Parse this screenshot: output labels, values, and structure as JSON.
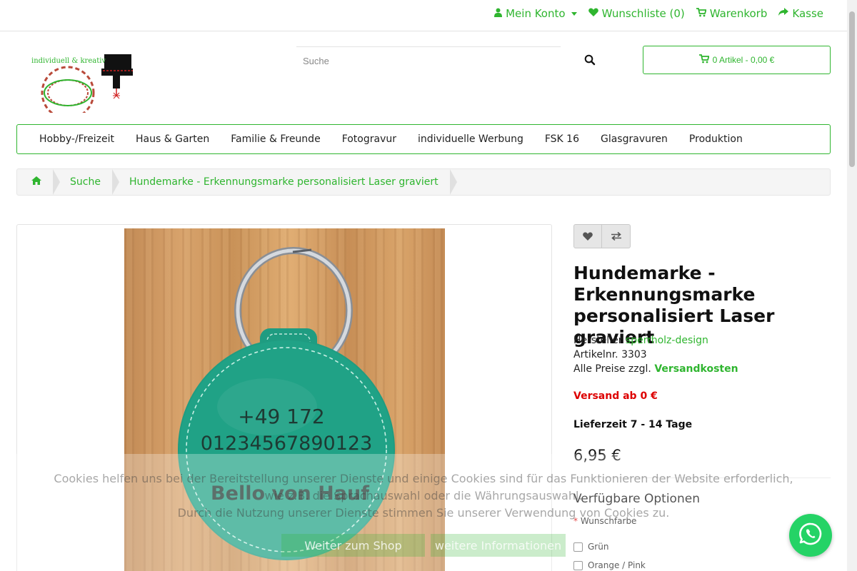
{
  "topbar": {
    "account": "Mein Konto",
    "wishlist": "Wunschliste (0)",
    "cart": "Warenkorb",
    "checkout": "Kasse"
  },
  "logo": {
    "text": "individuell & kreativ"
  },
  "search": {
    "placeholder": "Suche"
  },
  "cart_button": {
    "label": "0 Artikel - 0,00 €"
  },
  "nav": {
    "items": [
      "Hobby-/Freizeit",
      "Haus & Garten",
      "Familie & Freunde",
      "Fotogravur",
      "individuelle Werbung",
      "FSK 16",
      "Glasgravuren",
      "Produktion"
    ]
  },
  "breadcrumb": {
    "items": [
      "Suche",
      "Hundemarke - Erkennungsmarke personalisiert Laser graviert"
    ]
  },
  "product": {
    "title": "Hundemarke - Erkennungsmarke personalisiert Laser graviert",
    "manufacturer_label": "Hersteller",
    "manufacturer": "sperrholz-design",
    "article_label": "Artikelnr.",
    "article_no": "3303",
    "prices_note": "Alle Preise zzgl.",
    "shipping_link": "Versandkosten",
    "shipping_from": "Versand ab 0 €",
    "delivery": "Lieferzeit 7 - 14 Tage",
    "price": "6,95 €",
    "image": {
      "engraving_line1": "+49 172",
      "engraving_line2": "01234567890123",
      "engraving_line3": "Bello von Hauf"
    }
  },
  "options": {
    "title": "Verfügbare Optionen",
    "required_mark": "*",
    "label": "Wunschfarbe",
    "choices": [
      "Grün",
      "Orange / Pink"
    ]
  },
  "cookie": {
    "line1": "Cookies helfen uns bei der Bereitstellung unserer Dienste und einige Cookies sind für das Funktionieren der Website erforderlich,",
    "line2": "wie z.B. die Sprachauswahl oder die Währungsauswahl.",
    "line3": "Durch die Nutzung unserer Dienste stimmen Sie unserer Verwendung von Cookies zu.",
    "accept": "Weiter zum Shop",
    "more": "weitere Informationen"
  },
  "colors": {
    "accent": "#2fb52f",
    "warning": "#dd0000",
    "whatsapp": "#25d366"
  }
}
